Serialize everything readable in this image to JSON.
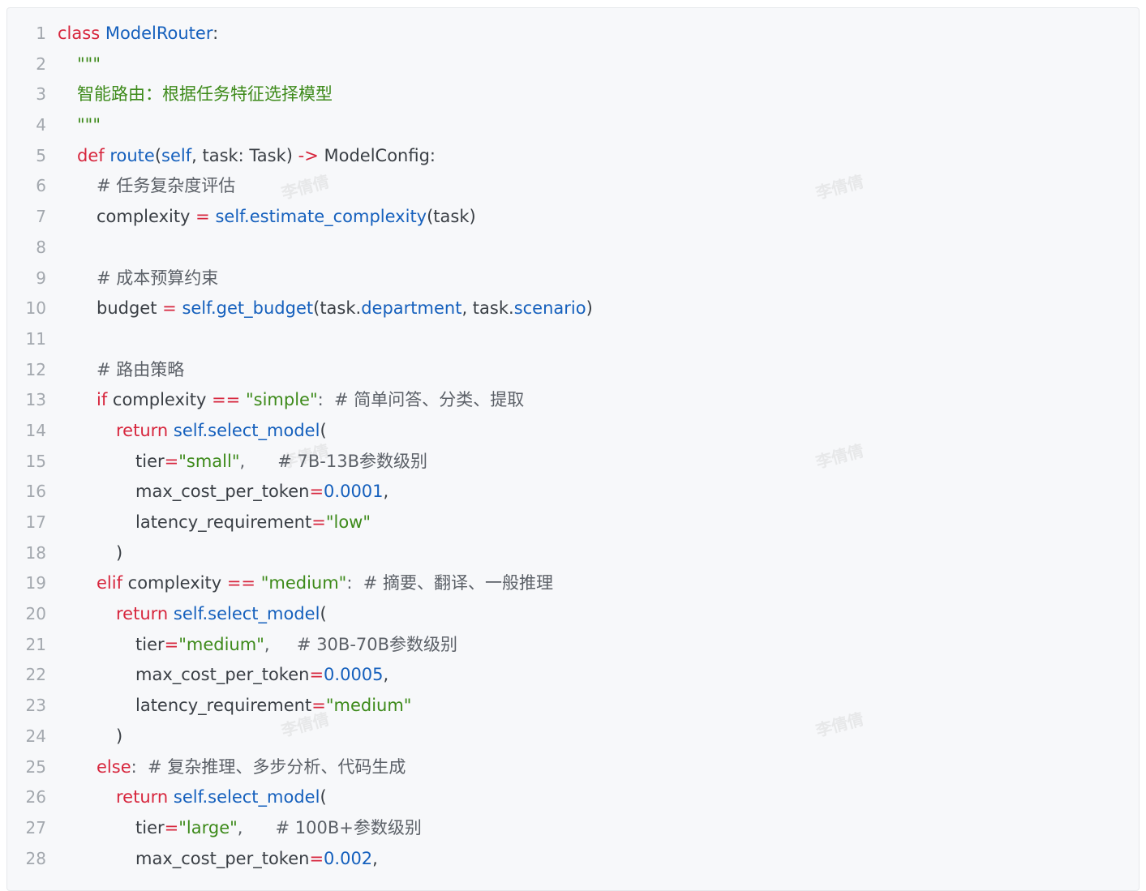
{
  "code": {
    "lines": [
      {
        "no": "1",
        "indent": 0,
        "tokens": [
          {
            "t": "class",
            "c": "kw"
          },
          {
            "t": " ",
            "c": "pl"
          },
          {
            "t": "ModelRouter",
            "c": "fn"
          },
          {
            "t": ":",
            "c": "pl"
          }
        ]
      },
      {
        "no": "2",
        "indent": 1,
        "tokens": [
          {
            "t": "\"\"\"",
            "c": "str"
          }
        ]
      },
      {
        "no": "3",
        "indent": 1,
        "tokens": [
          {
            "t": "智能路由：根据任务特征选择模型",
            "c": "str"
          }
        ]
      },
      {
        "no": "4",
        "indent": 1,
        "tokens": [
          {
            "t": "\"\"\"",
            "c": "str"
          }
        ]
      },
      {
        "no": "5",
        "indent": 1,
        "tokens": [
          {
            "t": "def",
            "c": "kw"
          },
          {
            "t": " ",
            "c": "pl"
          },
          {
            "t": "route",
            "c": "fn"
          },
          {
            "t": "(",
            "c": "pl"
          },
          {
            "t": "self",
            "c": "fn"
          },
          {
            "t": ", task: Task) ",
            "c": "pl"
          },
          {
            "t": "->",
            "c": "op"
          },
          {
            "t": " ModelConfig:",
            "c": "pl"
          }
        ]
      },
      {
        "no": "6",
        "indent": 2,
        "tokens": [
          {
            "t": "# 任务复杂度评估",
            "c": "cm"
          }
        ]
      },
      {
        "no": "7",
        "indent": 2,
        "tokens": [
          {
            "t": "complexity ",
            "c": "pl"
          },
          {
            "t": "=",
            "c": "op"
          },
          {
            "t": " ",
            "c": "pl"
          },
          {
            "t": "self.estimate_complexity",
            "c": "fn"
          },
          {
            "t": "(task)",
            "c": "pl"
          }
        ]
      },
      {
        "no": "8",
        "indent": 0,
        "tokens": []
      },
      {
        "no": "9",
        "indent": 2,
        "tokens": [
          {
            "t": "# 成本预算约束",
            "c": "cm"
          }
        ]
      },
      {
        "no": "10",
        "indent": 2,
        "tokens": [
          {
            "t": "budget ",
            "c": "pl"
          },
          {
            "t": "=",
            "c": "op"
          },
          {
            "t": " ",
            "c": "pl"
          },
          {
            "t": "self.get_budget",
            "c": "fn"
          },
          {
            "t": "(task.",
            "c": "pl"
          },
          {
            "t": "department",
            "c": "fn"
          },
          {
            "t": ", task.",
            "c": "pl"
          },
          {
            "t": "scenario",
            "c": "fn"
          },
          {
            "t": ")",
            "c": "pl"
          }
        ]
      },
      {
        "no": "11",
        "indent": 0,
        "tokens": []
      },
      {
        "no": "12",
        "indent": 2,
        "tokens": [
          {
            "t": "# 路由策略",
            "c": "cm"
          }
        ]
      },
      {
        "no": "13",
        "indent": 2,
        "tokens": [
          {
            "t": "if",
            "c": "kw"
          },
          {
            "t": " complexity ",
            "c": "pl"
          },
          {
            "t": "==",
            "c": "op"
          },
          {
            "t": " ",
            "c": "pl"
          },
          {
            "t": "\"simple\"",
            "c": "str"
          },
          {
            "t": ":  # 简单问答、分类、提取",
            "c": "cm"
          }
        ]
      },
      {
        "no": "14",
        "indent": 3,
        "tokens": [
          {
            "t": "return",
            "c": "kw"
          },
          {
            "t": " ",
            "c": "pl"
          },
          {
            "t": "self.select_model",
            "c": "fn"
          },
          {
            "t": "(",
            "c": "pl"
          }
        ]
      },
      {
        "no": "15",
        "indent": 4,
        "tokens": [
          {
            "t": "tier",
            "c": "pl"
          },
          {
            "t": "=",
            "c": "op"
          },
          {
            "t": "\"small\"",
            "c": "str"
          },
          {
            "t": ",      # 7B-13B参数级别",
            "c": "cm"
          }
        ]
      },
      {
        "no": "16",
        "indent": 4,
        "tokens": [
          {
            "t": "max_cost_per_token",
            "c": "pl"
          },
          {
            "t": "=",
            "c": "op"
          },
          {
            "t": "0.0001",
            "c": "num"
          },
          {
            "t": ",",
            "c": "pl"
          }
        ]
      },
      {
        "no": "17",
        "indent": 4,
        "tokens": [
          {
            "t": "latency_requirement",
            "c": "pl"
          },
          {
            "t": "=",
            "c": "op"
          },
          {
            "t": "\"low\"",
            "c": "str"
          }
        ]
      },
      {
        "no": "18",
        "indent": 3,
        "tokens": [
          {
            "t": ")",
            "c": "pl"
          }
        ]
      },
      {
        "no": "19",
        "indent": 2,
        "tokens": [
          {
            "t": "elif",
            "c": "kw"
          },
          {
            "t": " complexity ",
            "c": "pl"
          },
          {
            "t": "==",
            "c": "op"
          },
          {
            "t": " ",
            "c": "pl"
          },
          {
            "t": "\"medium\"",
            "c": "str"
          },
          {
            "t": ":  # 摘要、翻译、一般推理",
            "c": "cm"
          }
        ]
      },
      {
        "no": "20",
        "indent": 3,
        "tokens": [
          {
            "t": "return",
            "c": "kw"
          },
          {
            "t": " ",
            "c": "pl"
          },
          {
            "t": "self.select_model",
            "c": "fn"
          },
          {
            "t": "(",
            "c": "pl"
          }
        ]
      },
      {
        "no": "21",
        "indent": 4,
        "tokens": [
          {
            "t": "tier",
            "c": "pl"
          },
          {
            "t": "=",
            "c": "op"
          },
          {
            "t": "\"medium\"",
            "c": "str"
          },
          {
            "t": ",     # 30B-70B参数级别",
            "c": "cm"
          }
        ]
      },
      {
        "no": "22",
        "indent": 4,
        "tokens": [
          {
            "t": "max_cost_per_token",
            "c": "pl"
          },
          {
            "t": "=",
            "c": "op"
          },
          {
            "t": "0.0005",
            "c": "num"
          },
          {
            "t": ",",
            "c": "pl"
          }
        ]
      },
      {
        "no": "23",
        "indent": 4,
        "tokens": [
          {
            "t": "latency_requirement",
            "c": "pl"
          },
          {
            "t": "=",
            "c": "op"
          },
          {
            "t": "\"medium\"",
            "c": "str"
          }
        ]
      },
      {
        "no": "24",
        "indent": 3,
        "tokens": [
          {
            "t": ")",
            "c": "pl"
          }
        ]
      },
      {
        "no": "25",
        "indent": 2,
        "tokens": [
          {
            "t": "else",
            "c": "kw"
          },
          {
            "t": ":  # 复杂推理、多步分析、代码生成",
            "c": "cm"
          }
        ]
      },
      {
        "no": "26",
        "indent": 3,
        "tokens": [
          {
            "t": "return",
            "c": "kw"
          },
          {
            "t": " ",
            "c": "pl"
          },
          {
            "t": "self.select_model",
            "c": "fn"
          },
          {
            "t": "(",
            "c": "pl"
          }
        ]
      },
      {
        "no": "27",
        "indent": 4,
        "tokens": [
          {
            "t": "tier",
            "c": "pl"
          },
          {
            "t": "=",
            "c": "op"
          },
          {
            "t": "\"large\"",
            "c": "str"
          },
          {
            "t": ",      # 100B+参数级别",
            "c": "cm"
          }
        ]
      },
      {
        "no": "28",
        "indent": 4,
        "tokens": [
          {
            "t": "max_cost_per_token",
            "c": "pl"
          },
          {
            "t": "=",
            "c": "op"
          },
          {
            "t": "0.002",
            "c": "num"
          },
          {
            "t": ",",
            "c": "pl"
          }
        ]
      }
    ]
  },
  "watermark": {
    "text": "李倩倩"
  },
  "colors": {
    "keyword": "#d7263d",
    "function": "#1560bd",
    "string": "#3d8a1a",
    "comment": "#5c6168",
    "plain": "#3a3f45",
    "line_number": "#a3a8ae",
    "panel_background": "#f7f8fa"
  }
}
